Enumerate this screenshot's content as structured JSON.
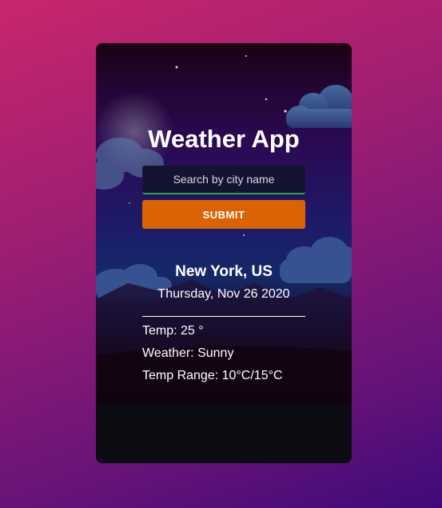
{
  "app": {
    "title": "Weather App"
  },
  "search": {
    "placeholder": "Search by city name",
    "value": ""
  },
  "submit": {
    "label": "SUBMIT"
  },
  "weather": {
    "location": "New York, US",
    "date": "Thursday, Nov 26 2020",
    "temp": "Temp: 25 °",
    "condition": "Weather: Sunny",
    "range": "Temp Range: 10°C/15°C"
  },
  "colors": {
    "submit_button": "#da6405",
    "search_underline": "#2fa34a",
    "text": "#ffffff"
  }
}
